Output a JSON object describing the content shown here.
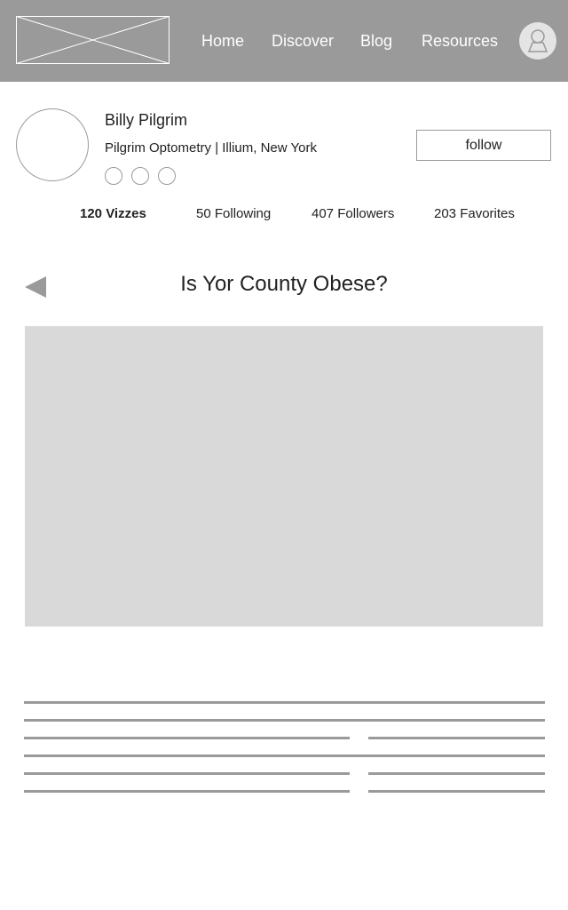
{
  "nav": {
    "items": [
      {
        "label": "Home"
      },
      {
        "label": "Discover"
      },
      {
        "label": "Blog"
      },
      {
        "label": "Resources"
      }
    ]
  },
  "profile": {
    "name": "Billy Pilgrim",
    "subtitle": "Pilgrim Optometry | Illium, New York",
    "follow_label": "follow"
  },
  "stats": [
    {
      "label": "120 Vizzes",
      "active": true
    },
    {
      "label": "50 Following",
      "active": false
    },
    {
      "label": "407 Followers",
      "active": false
    },
    {
      "label": "203 Favorites",
      "active": false
    }
  ],
  "viz": {
    "title": "Is Yor County Obese?"
  },
  "colors": {
    "header_bg": "#9a9a9a",
    "placeholder": "#d9d9d9",
    "line": "#9a9a9a"
  }
}
